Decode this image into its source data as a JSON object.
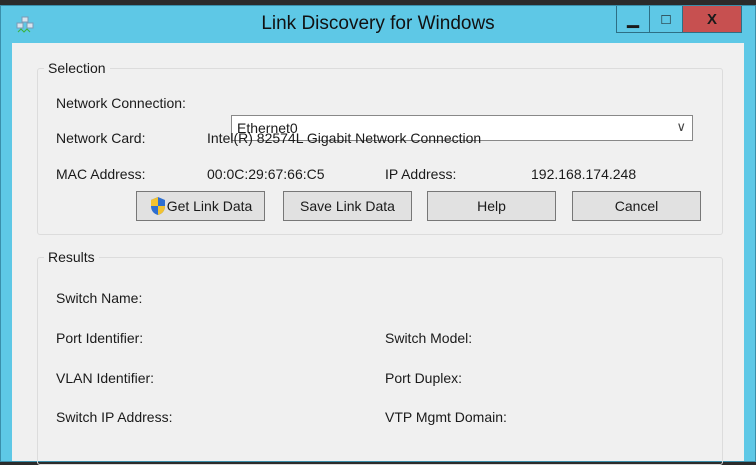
{
  "window": {
    "title": "Link Discovery for Windows",
    "minimize": "▁",
    "maximize": "□",
    "close": "X"
  },
  "selection": {
    "legend": "Selection",
    "network_connection_label": "Network Connection:",
    "network_connection_value": "Ethernet0",
    "network_card_label": "Network Card:",
    "network_card_value": "Intel(R) 82574L Gigabit Network Connection",
    "mac_label": "MAC Address:",
    "mac_value": "00:0C:29:67:66:C5",
    "ip_label": "IP Address:",
    "ip_value": "192.168.174.248"
  },
  "buttons": {
    "get": "Get Link Data",
    "save": "Save Link Data",
    "help": "Help",
    "cancel": "Cancel"
  },
  "results": {
    "legend": "Results",
    "switch_name": "Switch Name:",
    "port_identifier": "Port Identifier:",
    "switch_model": "Switch Model:",
    "vlan_identifier": "VLAN Identifier:",
    "port_duplex": "Port Duplex:",
    "switch_ip": "Switch IP Address:",
    "vtp_domain": "VTP Mgmt Domain:"
  }
}
